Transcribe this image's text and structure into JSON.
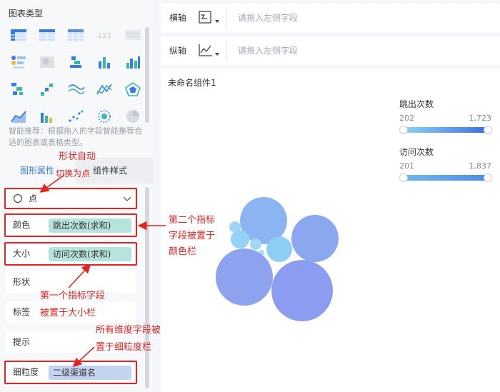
{
  "left": {
    "chart_type_title": "图表类型",
    "recommend": "智能推荐：根据拖入的字段智能推荐合适的图表或表格类型。",
    "tabs": {
      "shape": "图形属性",
      "style": "组件样式"
    },
    "shape_select": {
      "value": "点"
    },
    "fields": {
      "color": {
        "label": "颜色",
        "value": "跳出次数(求和)"
      },
      "size": {
        "label": "大小",
        "value": "访问次数(求和)"
      },
      "shape": {
        "label": "形状"
      },
      "label": {
        "label": "标签"
      },
      "tooltip": {
        "label": "提示"
      },
      "granularity": {
        "label": "细粒度",
        "value": "二级渠道名"
      }
    }
  },
  "axes": {
    "x": {
      "label": "横轴",
      "placeholder": "请拖入左侧字段"
    },
    "y": {
      "label": "纵轴",
      "placeholder": "请拖入左侧字段"
    }
  },
  "canvas": {
    "widget_title": "未命名组件1",
    "legends": [
      {
        "title": "跳出次数",
        "min": "202",
        "max": "1,723",
        "gradient": [
          "#8cd3f3",
          "#3f6fe0"
        ]
      },
      {
        "title": "访问次数",
        "min": "201",
        "max": "1,837",
        "gradient": [
          "#6fb6f0",
          "#4a8de6"
        ]
      }
    ]
  },
  "annotations": {
    "shape_auto": "形状自动",
    "switch_point": "切换为点",
    "second_metric": [
      "第二个指标",
      "字段被置于",
      "颜色栏"
    ],
    "first_metric": [
      "第一个指标字段",
      "被置于大小栏"
    ],
    "dimension": [
      "所有维度字段被",
      "置于细粒度栏"
    ]
  },
  "colors": {
    "accent": "#3a7be0",
    "annotation_red": "#e02424",
    "bubble_light": "#8cd3f3",
    "bubble_dark": "#8c9cf0"
  }
}
